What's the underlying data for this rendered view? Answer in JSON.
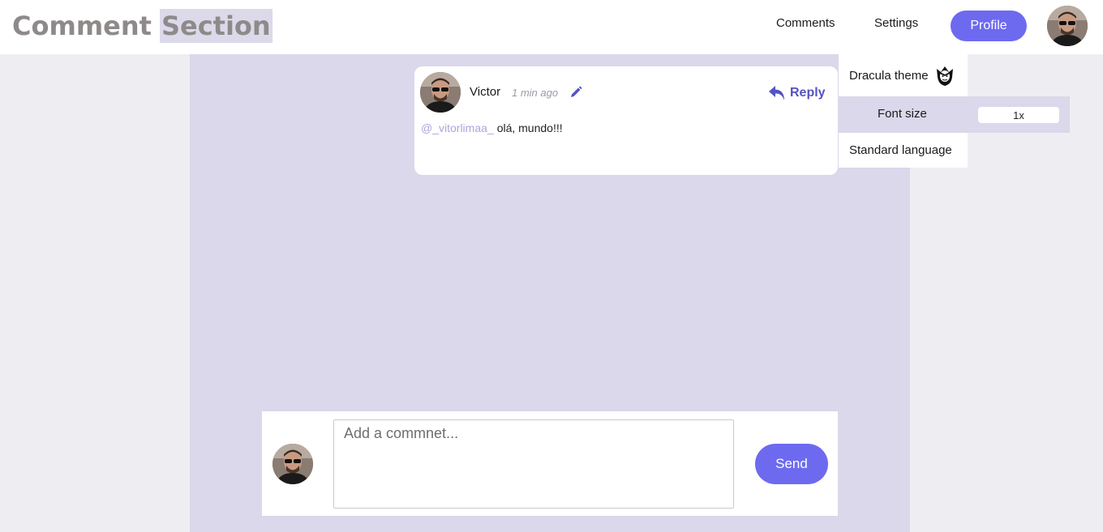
{
  "header": {
    "logo_word1": "Comment",
    "logo_word2": "Section",
    "nav": {
      "comments": "Comments",
      "settings": "Settings"
    },
    "profile_button": "Profile"
  },
  "settings_menu": {
    "dracula_theme": "Dracula theme",
    "dracula_icon": "dracula-icon",
    "font_size_label": "Font size",
    "font_size_value": "1x",
    "language": "Standard language"
  },
  "comment": {
    "user": "Victor",
    "time": "1 min ago",
    "mention": "@_vitorlimaa_",
    "text": "olá, mundo!!!",
    "reply_label": "Reply",
    "edit_icon": "pencil-icon",
    "reply_icon": "reply-arrow-icon"
  },
  "composer": {
    "placeholder": "Add a commnet...",
    "value": "",
    "send_label": "Send"
  },
  "colors": {
    "accent": "#6d6af0",
    "reply": "#5453c0",
    "main_bg": "#dad8ea",
    "page_bg": "#eeeef2",
    "mention": "#a8a6dc",
    "logo": "#8f8a8a"
  }
}
